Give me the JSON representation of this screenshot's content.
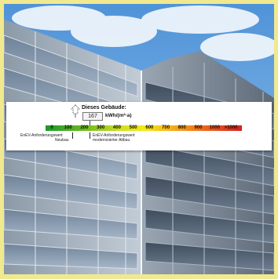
{
  "energy_label": {
    "title": "Dieses Gebäude:",
    "value": "167",
    "unit": "kWh/(m²·a)",
    "scale_ticks": [
      "0",
      "100",
      "200",
      "300",
      "400",
      "500",
      "600",
      "700",
      "800",
      "900",
      "1000",
      ">1000"
    ],
    "reference_new_line1": "EnEV-Anforderungswert",
    "reference_new_line2": "Neubau",
    "reference_modernized_line1": "EnEV-Anforderungswert",
    "reference_modernized_line2": "modernisierter Altbau",
    "colors": {
      "scale_start": "#1a9a2a",
      "scale_middle": "#f2ea14",
      "scale_end": "#d81e1e"
    }
  },
  "frame": {
    "color": "#f1e98f"
  }
}
